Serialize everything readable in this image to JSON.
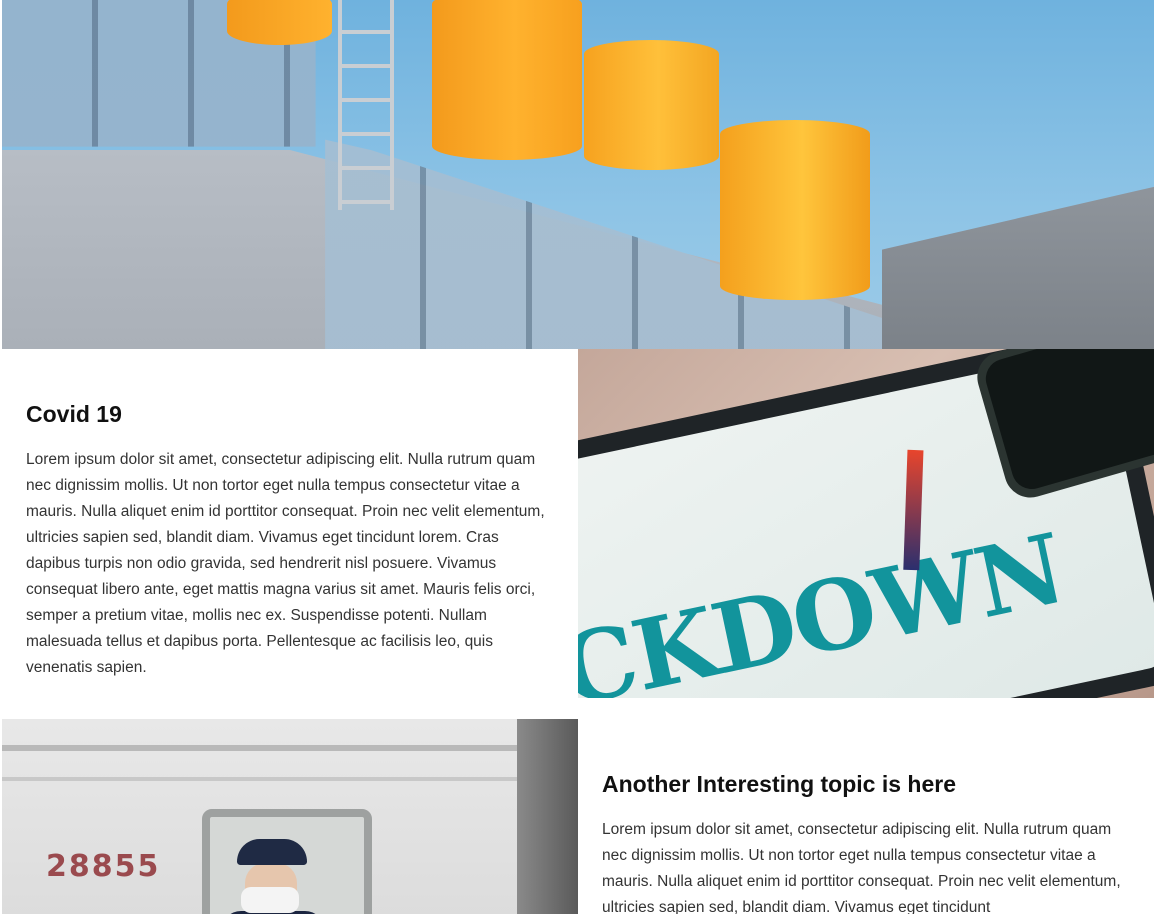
{
  "hero": {
    "image_name": "building-with-orange-tanks"
  },
  "sections": [
    {
      "title": "Covid 19",
      "body": "Lorem ipsum dolor sit amet, consectetur adipiscing elit. Nulla rutrum quam nec dignissim mollis. Ut non tortor eget nulla tempus consectetur vitae a mauris. Nulla aliquet enim id porttitor consequat. Proin nec velit elementum, ultricies sapien sed, blandit diam. Vivamus eget tincidunt lorem. Cras dapibus turpis non odio gravida, sed hendrerit nisl posuere. Vivamus consequat libero ante, eget mattis magna varius sit amet. Mauris felis orci, semper a pretium vitae, mollis nec ex. Suspendisse potenti. Nullam malesuada tellus et dapibus porta. Pellentesque ac facilisis leo, quis venenatis sapien.",
      "image_text": "CKDOWN"
    },
    {
      "title": "Another Interesting topic is here",
      "body": "Lorem ipsum dolor sit amet, consectetur adipiscing elit. Nulla rutrum quam nec dignissim mollis. Ut non tortor eget nulla tempus consectetur vitae a mauris. Nulla aliquet enim id porttitor consequat. Proin nec velit elementum, ultricies sapien sed, blandit diam. Vivamus eget tincidunt",
      "image_text": "28855"
    }
  ]
}
